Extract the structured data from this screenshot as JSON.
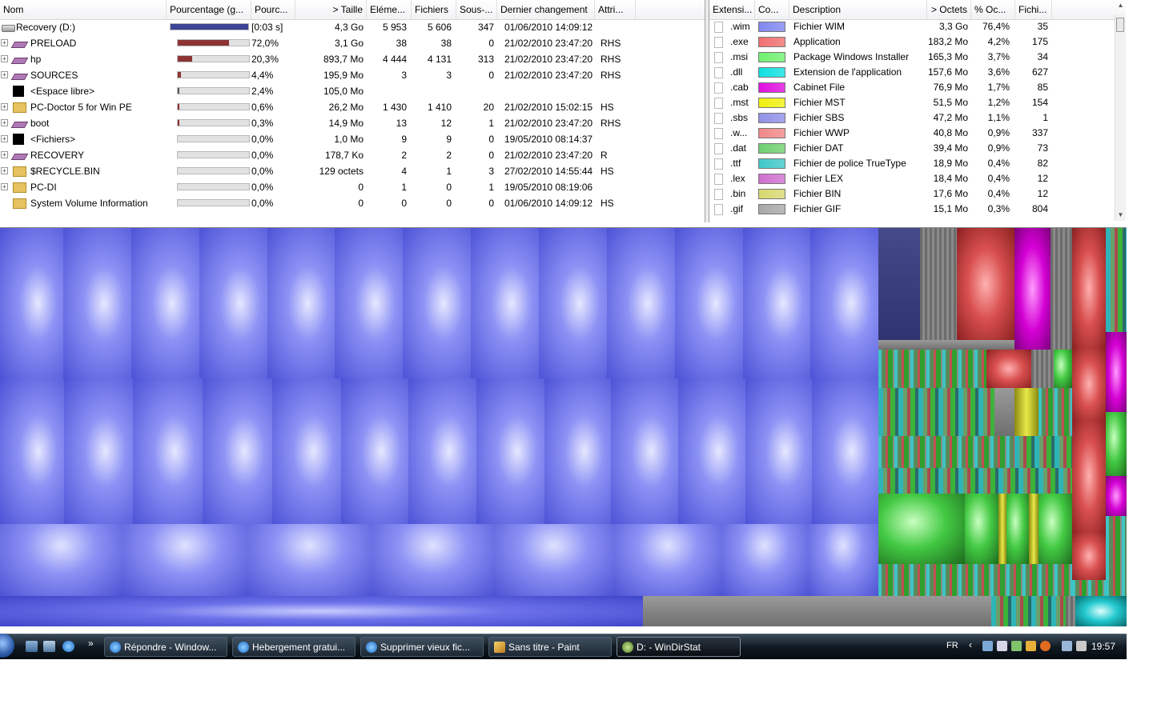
{
  "dir_headers": [
    "Nom",
    "Pourcentage (g...",
    "Pourc...",
    "> Taille",
    "Eléme...",
    "Fichiers",
    "Sous-...",
    "Dernier changement",
    "Attri..."
  ],
  "dir_rows": [
    {
      "name": "Recovery (D:)",
      "icon": "drive-icon",
      "expander": false,
      "pct_fill": 1.0,
      "bar_color": "#3c4496",
      "pct": "[0:03 s]",
      "size": "4,3 Go",
      "items": "5 953",
      "files": "5 606",
      "subdirs": "347",
      "date": "01/06/2010  14:09:12",
      "attr": ""
    },
    {
      "name": "PRELOAD",
      "icon": "hp-drive-icon",
      "expander": true,
      "pct_fill": 0.72,
      "bar_color": "#8c3434",
      "pct": "72,0%",
      "size": "3,1 Go",
      "items": "38",
      "files": "38",
      "subdirs": "0",
      "date": "21/02/2010  23:47:20",
      "attr": "RHS"
    },
    {
      "name": "hp",
      "icon": "hp-drive-icon",
      "expander": true,
      "pct_fill": 0.203,
      "bar_color": "#8c3434",
      "pct": "20,3%",
      "size": "893,7 Mo",
      "items": "4 444",
      "files": "4 131",
      "subdirs": "313",
      "date": "21/02/2010  23:47:20",
      "attr": "RHS"
    },
    {
      "name": "SOURCES",
      "icon": "hp-drive-icon",
      "expander": true,
      "pct_fill": 0.044,
      "bar_color": "#8c3434",
      "pct": "4,4%",
      "size": "195,9 Mo",
      "items": "3",
      "files": "3",
      "subdirs": "0",
      "date": "21/02/2010  23:47:20",
      "attr": "RHS"
    },
    {
      "name": "<Espace libre>",
      "icon": "free-space-icon",
      "expander": false,
      "pct_fill": 0.024,
      "bar_color": "#555555",
      "pct": "2,4%",
      "size": "105,0 Mo",
      "items": "",
      "files": "",
      "subdirs": "",
      "date": "",
      "attr": ""
    },
    {
      "name": "PC-Doctor 5 for Win PE",
      "icon": "folder-icon",
      "expander": true,
      "pct_fill": 0.006,
      "bar_color": "#8c3434",
      "pct": "0,6%",
      "size": "26,2 Mo",
      "items": "1 430",
      "files": "1 410",
      "subdirs": "20",
      "date": "21/02/2010  15:02:15",
      "attr": "HS"
    },
    {
      "name": "boot",
      "icon": "hp-drive-icon",
      "expander": true,
      "pct_fill": 0.003,
      "bar_color": "#8c3434",
      "pct": "0,3%",
      "size": "14,9 Mo",
      "items": "13",
      "files": "12",
      "subdirs": "1",
      "date": "21/02/2010  23:47:20",
      "attr": "RHS"
    },
    {
      "name": "<Fichiers>",
      "icon": "files-icon",
      "expander": true,
      "pct_fill": 0.0,
      "bar_color": "#8c3434",
      "pct": "0,0%",
      "size": "1,0 Mo",
      "items": "9",
      "files": "9",
      "subdirs": "0",
      "date": "19/05/2010  08:14:37",
      "attr": ""
    },
    {
      "name": "RECOVERY",
      "icon": "hp-drive-icon",
      "expander": true,
      "pct_fill": 0.0,
      "bar_color": "#8c3434",
      "pct": "0,0%",
      "size": "178,7 Ko",
      "items": "2",
      "files": "2",
      "subdirs": "0",
      "date": "21/02/2010  23:47:20",
      "attr": "R"
    },
    {
      "name": "$RECYCLE.BIN",
      "icon": "folder-icon",
      "expander": true,
      "pct_fill": 0.0,
      "bar_color": "#8c3434",
      "pct": "0,0%",
      "size": "129 octets",
      "items": "4",
      "files": "1",
      "subdirs": "3",
      "date": "27/02/2010  14:55:44",
      "attr": "HS"
    },
    {
      "name": "PC-DI",
      "icon": "folder-icon",
      "expander": true,
      "pct_fill": 0.0,
      "bar_color": "#8c3434",
      "pct": "0,0%",
      "size": "0",
      "items": "1",
      "files": "0",
      "subdirs": "1",
      "date": "19/05/2010  08:19:06",
      "attr": ""
    },
    {
      "name": "System Volume Information",
      "icon": "folder-icon",
      "expander": false,
      "pct_fill": 0.0,
      "bar_color": "#8c3434",
      "pct": "0,0%",
      "size": "0",
      "items": "0",
      "files": "0",
      "subdirs": "0",
      "date": "01/06/2010  14:09:12",
      "attr": "HS"
    }
  ],
  "ext_headers": [
    "Extensi...",
    "Co...",
    "Description",
    "> Octets",
    "% Oc...",
    "Fichi..."
  ],
  "ext_rows": [
    {
      "ext": ".wim",
      "color": "#8088f0",
      "desc": "Fichier WIM",
      "bytes": "3,3 Go",
      "pct": "76,4%",
      "files": "35"
    },
    {
      "ext": ".exe",
      "color": "#f07070",
      "desc": "Application",
      "bytes": "183,2 Mo",
      "pct": "4,2%",
      "files": "175"
    },
    {
      "ext": ".msi",
      "color": "#70f070",
      "desc": "Package Windows Installer",
      "bytes": "165,3 Mo",
      "pct": "3,7%",
      "files": "34"
    },
    {
      "ext": ".dll",
      "color": "#10e0e0",
      "desc": "Extension de l'application",
      "bytes": "157,6 Mo",
      "pct": "3,6%",
      "files": "627"
    },
    {
      "ext": ".cab",
      "color": "#e010e0",
      "desc": "Cabinet File",
      "bytes": "76,9 Mo",
      "pct": "1,7%",
      "files": "85"
    },
    {
      "ext": ".mst",
      "color": "#f0f010",
      "desc": "Fichier MST",
      "bytes": "51,5 Mo",
      "pct": "1,2%",
      "files": "154"
    },
    {
      "ext": ".sbs",
      "color": "#9090e8",
      "desc": "Fichier SBS",
      "bytes": "47,2 Mo",
      "pct": "1,1%",
      "files": "1"
    },
    {
      "ext": ".w...",
      "color": "#f08888",
      "desc": "Fichier WWP",
      "bytes": "40,8 Mo",
      "pct": "0,9%",
      "files": "337"
    },
    {
      "ext": ".dat",
      "color": "#70d070",
      "desc": "Fichier DAT",
      "bytes": "39,4 Mo",
      "pct": "0,9%",
      "files": "73"
    },
    {
      "ext": ".ttf",
      "color": "#40c8c8",
      "desc": "Fichier de police TrueType",
      "bytes": "18,9 Mo",
      "pct": "0,4%",
      "files": "82"
    },
    {
      "ext": ".lex",
      "color": "#d070d0",
      "desc": "Fichier LEX",
      "bytes": "18,4 Mo",
      "pct": "0,4%",
      "files": "12"
    },
    {
      "ext": ".bin",
      "color": "#d8d870",
      "desc": "Fichier BIN",
      "bytes": "17,6 Mo",
      "pct": "0,4%",
      "files": "12"
    },
    {
      "ext": ".gif",
      "color": "#a8a8a8",
      "desc": "Fichier GIF",
      "bytes": "15,1 Mo",
      "pct": "0,3%",
      "files": "804"
    }
  ],
  "taskbar": {
    "quicklaunch": [
      "show-desktop-icon",
      "switch-windows-icon",
      "internet-explorer-icon"
    ],
    "more": "»",
    "buttons": [
      {
        "label": "Répondre - Window...",
        "icon": "internet-explorer-icon",
        "active": false
      },
      {
        "label": "Hebergement gratui...",
        "icon": "internet-explorer-icon",
        "active": false
      },
      {
        "label": "Supprimer vieux fic...",
        "icon": "internet-explorer-icon",
        "active": false
      },
      {
        "label": "Sans titre - Paint",
        "icon": "paint-icon",
        "active": false
      },
      {
        "label": "D: - WinDirStat",
        "icon": "windirstat-icon",
        "active": true
      }
    ],
    "lang": "FR",
    "clock": "19:57"
  }
}
